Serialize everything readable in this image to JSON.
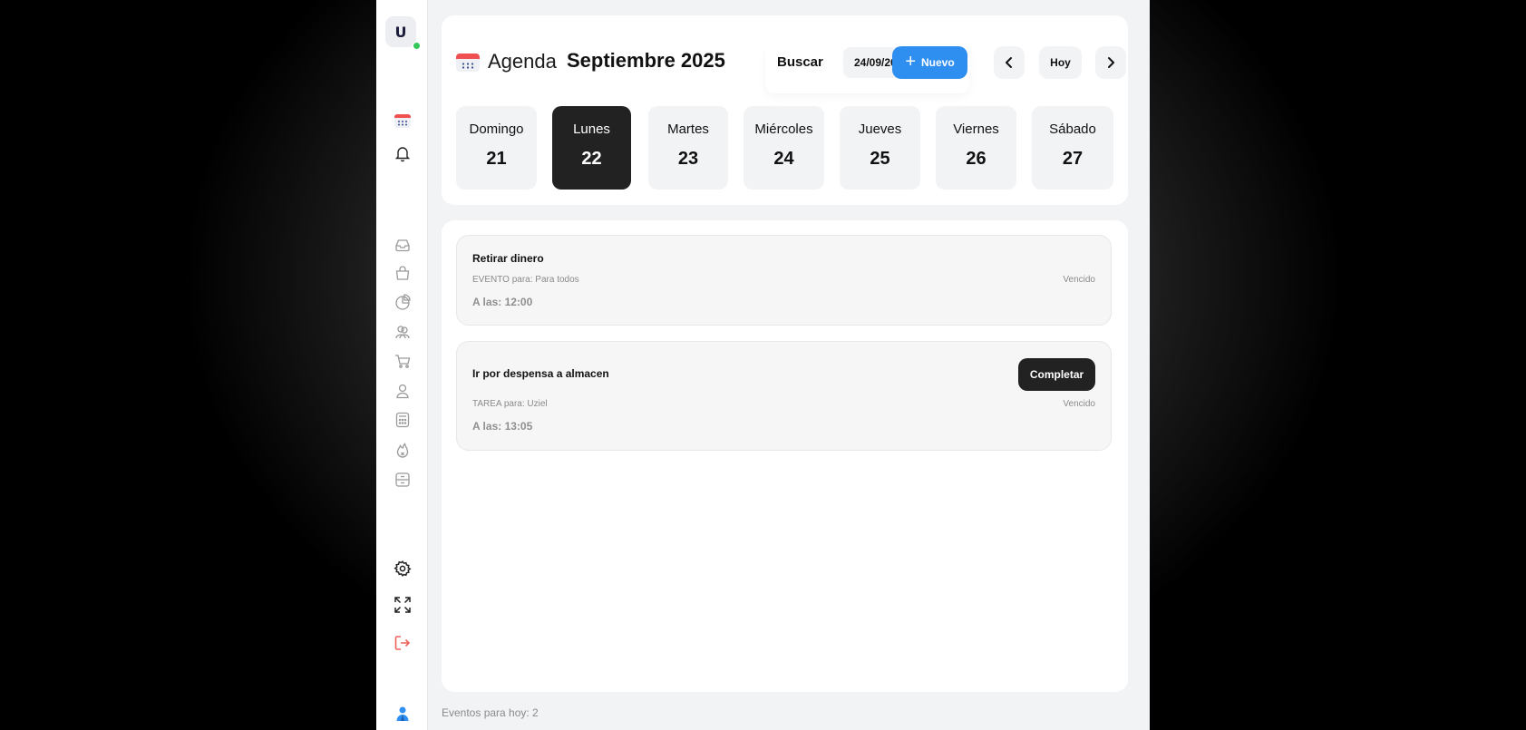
{
  "sidebar": {
    "avatar_letter": "U",
    "items": [
      {
        "icon": "calendar-icon"
      },
      {
        "icon": "bell-icon"
      },
      {
        "icon": "inbox-icon"
      },
      {
        "icon": "bag-icon"
      },
      {
        "icon": "pie-chart-icon"
      },
      {
        "icon": "users-icon"
      },
      {
        "icon": "cart-icon"
      },
      {
        "icon": "user-icon"
      },
      {
        "icon": "calculator-icon"
      },
      {
        "icon": "fire-icon"
      },
      {
        "icon": "archive-icon"
      },
      {
        "icon": "gear-icon"
      },
      {
        "icon": "fullscreen-icon"
      },
      {
        "icon": "logout-icon"
      },
      {
        "icon": "profile-icon"
      }
    ],
    "colors": {
      "online": "#34c759",
      "logout": "#f0605a",
      "profile": "#2f8ff0"
    }
  },
  "header": {
    "title": "Agenda",
    "month": "Septiembre 2025",
    "search_label": "Buscar",
    "date_value": "24/09/2025",
    "new_label": "Nuevo",
    "today_label": "Hoy"
  },
  "days": [
    {
      "name": "Domingo",
      "num": "21",
      "active": false
    },
    {
      "name": "Lunes",
      "num": "22",
      "active": true
    },
    {
      "name": "Martes",
      "num": "23",
      "active": false
    },
    {
      "name": "Miércoles",
      "num": "24",
      "active": false
    },
    {
      "name": "Jueves",
      "num": "25",
      "active": false
    },
    {
      "name": "Viernes",
      "num": "26",
      "active": false
    },
    {
      "name": "Sábado",
      "num": "27",
      "active": false
    }
  ],
  "events": [
    {
      "title": "Retirar dinero",
      "meta": "EVENTO para: Para todos",
      "status": "Vencido",
      "time": "A las: 12:00"
    },
    {
      "title": "Ir por despensa a almacen",
      "meta": "TAREA para: Uziel",
      "status": "Vencido",
      "time": "A las: 13:05",
      "action_label": "Completar"
    }
  ],
  "footer": {
    "count_text": "Eventos para hoy: 2"
  },
  "colors": {
    "accent": "#2f8ff0",
    "active_day": "#222222",
    "calendar_red": "#f05050"
  }
}
